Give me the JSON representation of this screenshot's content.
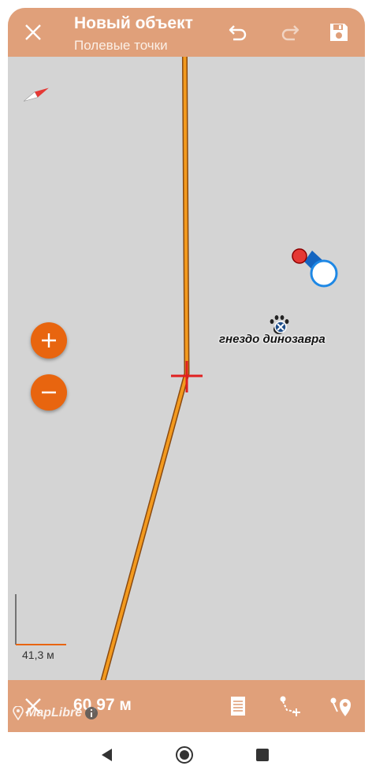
{
  "header": {
    "title": "Новый объект",
    "subtitle": "Полевые точки"
  },
  "map": {
    "poi_label": "гнездо динозавра",
    "scale_label": "41,3 м",
    "attribution": "MapLibre"
  },
  "bottom_bar": {
    "distance": "60,97 м"
  },
  "colors": {
    "header_bg": "#e0a07a",
    "map_bg": "#d4d4d4",
    "accent_orange": "#e8650f",
    "line_orange": "#f08a10",
    "cursor_red": "#e02020",
    "location_blue": "#1565c0"
  },
  "icons": {
    "close": "close-icon",
    "undo": "undo-icon",
    "redo": "redo-icon",
    "save": "save-icon",
    "zoom_in": "plus-icon",
    "zoom_out": "minus-icon",
    "attributes": "list-icon",
    "add_vertex": "add-vertex-icon",
    "locate": "location-pin-icon"
  }
}
